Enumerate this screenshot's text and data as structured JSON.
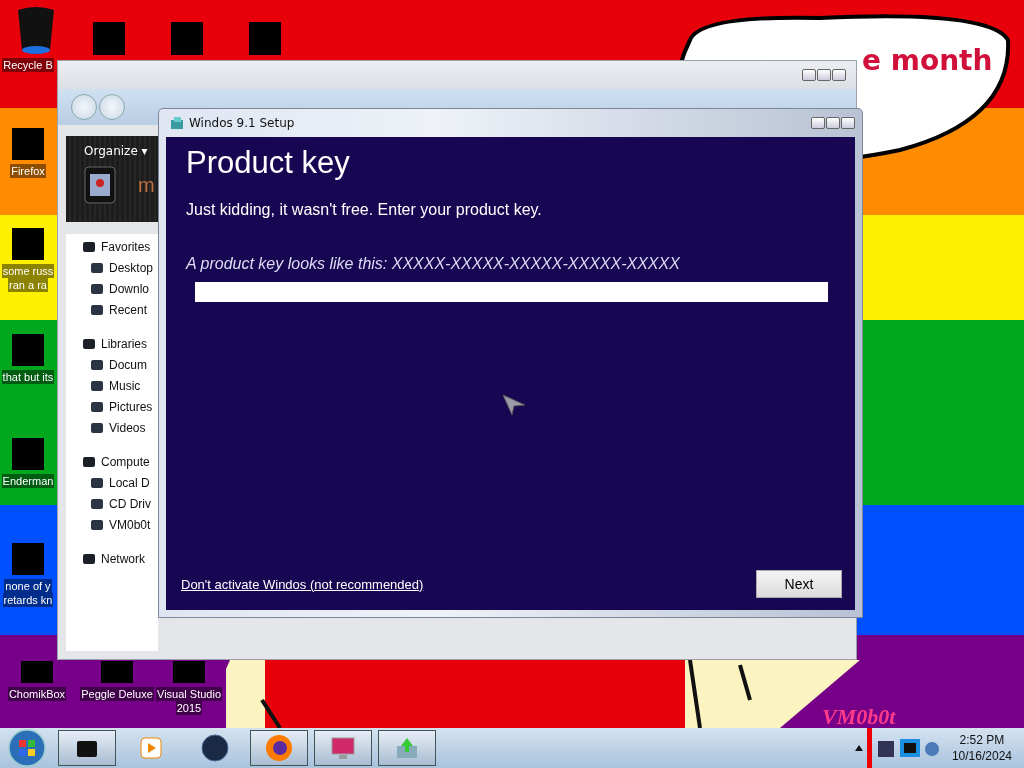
{
  "desktop": {
    "banner_text": "e month",
    "wallpaper_mark": "VM0b0t",
    "icons": [
      {
        "lines": [
          "Recycle B"
        ]
      },
      {
        "lines": [
          "Firefox"
        ]
      },
      {
        "lines": [
          "some russ",
          "ran a ra"
        ]
      },
      {
        "lines": [
          "that but its"
        ]
      },
      {
        "lines": [
          "Enderman"
        ]
      },
      {
        "lines": [
          "none of y",
          "retards kn"
        ]
      },
      {
        "lines": [
          "ChomikBox"
        ]
      },
      {
        "lines": [
          "Peggle Deluxe"
        ]
      },
      {
        "lines": [
          "Visual Studio",
          "2015"
        ]
      }
    ]
  },
  "explorer": {
    "toolbar": {
      "organize": "Organize",
      "organize_caret": "▾",
      "folder_letter": "m"
    },
    "nav": [
      {
        "label": "Favorites",
        "children": [
          {
            "label": "Desktop"
          },
          {
            "label": "Downlo"
          },
          {
            "label": "Recent"
          }
        ]
      },
      {
        "label": "Libraries",
        "children": [
          {
            "label": "Docum"
          },
          {
            "label": "Music"
          },
          {
            "label": "Pictures"
          },
          {
            "label": "Videos"
          }
        ]
      },
      {
        "label": "Compute",
        "children": [
          {
            "label": "Local D"
          },
          {
            "label": "CD Driv"
          },
          {
            "label": "VM0b0t"
          }
        ]
      },
      {
        "label": "Network"
      }
    ]
  },
  "setup": {
    "title": "Windos 9.1 Setup",
    "heading": "Product key",
    "intro": "Just kidding, it wasn't free. Enter your product key.",
    "hint": "A product key looks like this: XXXXX-XXXXX-XXXXX-XXXXX-XXXXX",
    "skip_link": "Don't activate Windos (not recommended)",
    "next_button": "Next"
  },
  "taskbar": {
    "time": "2:52 PM",
    "date": "10/16/2024"
  }
}
